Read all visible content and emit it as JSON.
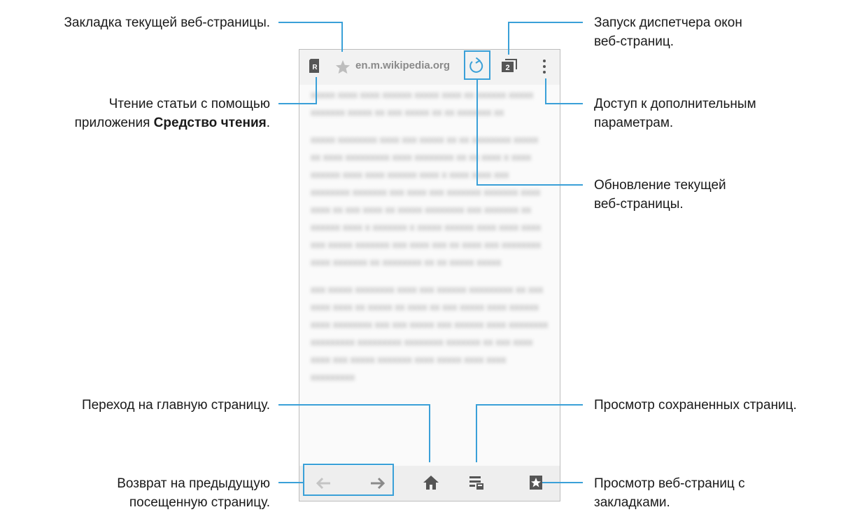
{
  "callouts": {
    "bookmark_current": "Закладка текущей веб-страницы.",
    "reader_line1": "Чтение статьи с помощью",
    "reader_line2_prefix": "приложения ",
    "reader_line2_bold": "Средство чтения",
    "reader_line2_suffix": ".",
    "home": "Переход на главную страницу.",
    "back_line1": "Возврат на предыдущую",
    "back_line2": "посещенную страницу.",
    "window_manager_line1": "Запуск диспетчера окон",
    "window_manager_line2": "веб-страниц.",
    "more_options_line1": "Доступ к дополнительным",
    "more_options_line2": "параметрам.",
    "refresh_line1": "Обновление текущей",
    "refresh_line2": "веб-страницы.",
    "saved_pages": "Просмотр сохраненных страниц.",
    "bookmarks_line1": "Просмотр веб-страниц с",
    "bookmarks_line2": "закладками."
  },
  "browser": {
    "url": "en.m.wikipedia.org",
    "tab_count": "2",
    "reader_badge": "R",
    "accent_color": "#3aa0d8",
    "icons": [
      "reader-icon",
      "star-icon",
      "refresh-icon",
      "tabs-icon",
      "more-icon",
      "back-icon",
      "forward-icon",
      "home-icon",
      "saved-pages-icon",
      "bookmarks-icon"
    ]
  }
}
